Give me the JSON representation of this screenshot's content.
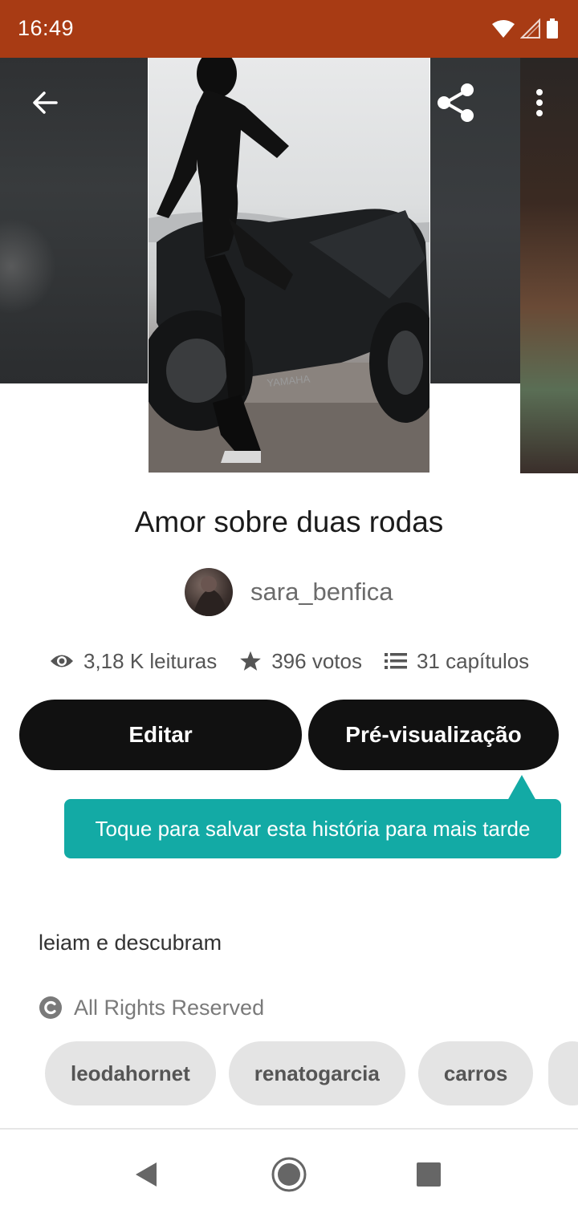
{
  "status_bar": {
    "time": "16:49"
  },
  "story": {
    "title": "Amor sobre duas rodas",
    "author": "sara_benfica",
    "reads": "3,18 K leituras",
    "votes": "396 votos",
    "chapters": "31 capítulos",
    "description": "leiam e descubram",
    "license": "All Rights Reserved",
    "cover_text": "YAMAHA"
  },
  "actions": {
    "edit_label": "Editar",
    "preview_label": "Pré-visualização"
  },
  "tooltip": {
    "text": "Toque para salvar esta história para mais tarde"
  },
  "tags": [
    "leodahornet",
    "renatogarcia",
    "carros"
  ],
  "icons": {
    "back": "arrow-left-icon",
    "share": "share-icon",
    "more": "more-vertical-icon",
    "reads": "eye-icon",
    "votes": "star-icon",
    "chapters": "list-icon",
    "license": "copyright-icon"
  },
  "colors": {
    "status_bar": "#a83b14",
    "tooltip": "#13aaa5",
    "button": "#111111",
    "tag_bg": "#e4e4e4"
  }
}
